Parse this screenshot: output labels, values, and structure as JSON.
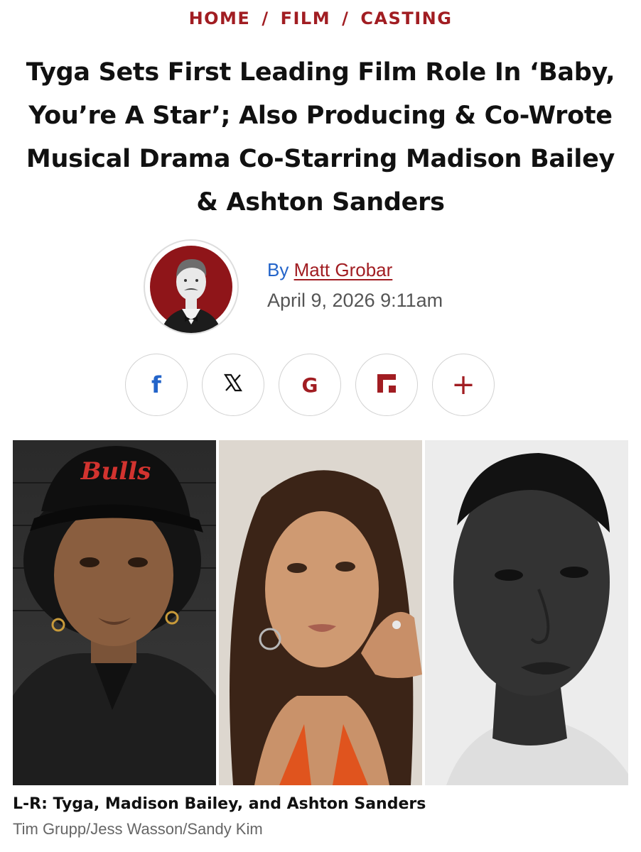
{
  "breadcrumb": {
    "items": [
      "HOME",
      "FILM",
      "CASTING"
    ],
    "separator": "/"
  },
  "headline": "Tyga Sets First Leading Film Role In ‘Baby, You’re A Star’; Also Producing & Co-Wrote Musical Drama Co-Starring Madison Bailey & Ashton Sanders",
  "byline": {
    "prefix": "By",
    "author": "Matt Grobar",
    "date": "April 9, 2026 9:11am"
  },
  "share": {
    "icons": [
      "facebook-icon",
      "x-icon",
      "google-icon",
      "flipboard-icon",
      "plus-icon"
    ],
    "facebook_glyph": "f",
    "x_glyph": "𝕏",
    "google_glyph": "G",
    "plus_glyph": "+"
  },
  "image": {
    "caption": "L-R: Tyga, Madison Bailey, and Ashton Sanders",
    "credit": "Tim Grupp/Jess Wasson/Sandy Kim",
    "cap_text": "Bulls"
  },
  "colors": {
    "accent": "#a11d22",
    "link_blue": "#2364c9",
    "text": "#111111",
    "muted": "#666666"
  }
}
